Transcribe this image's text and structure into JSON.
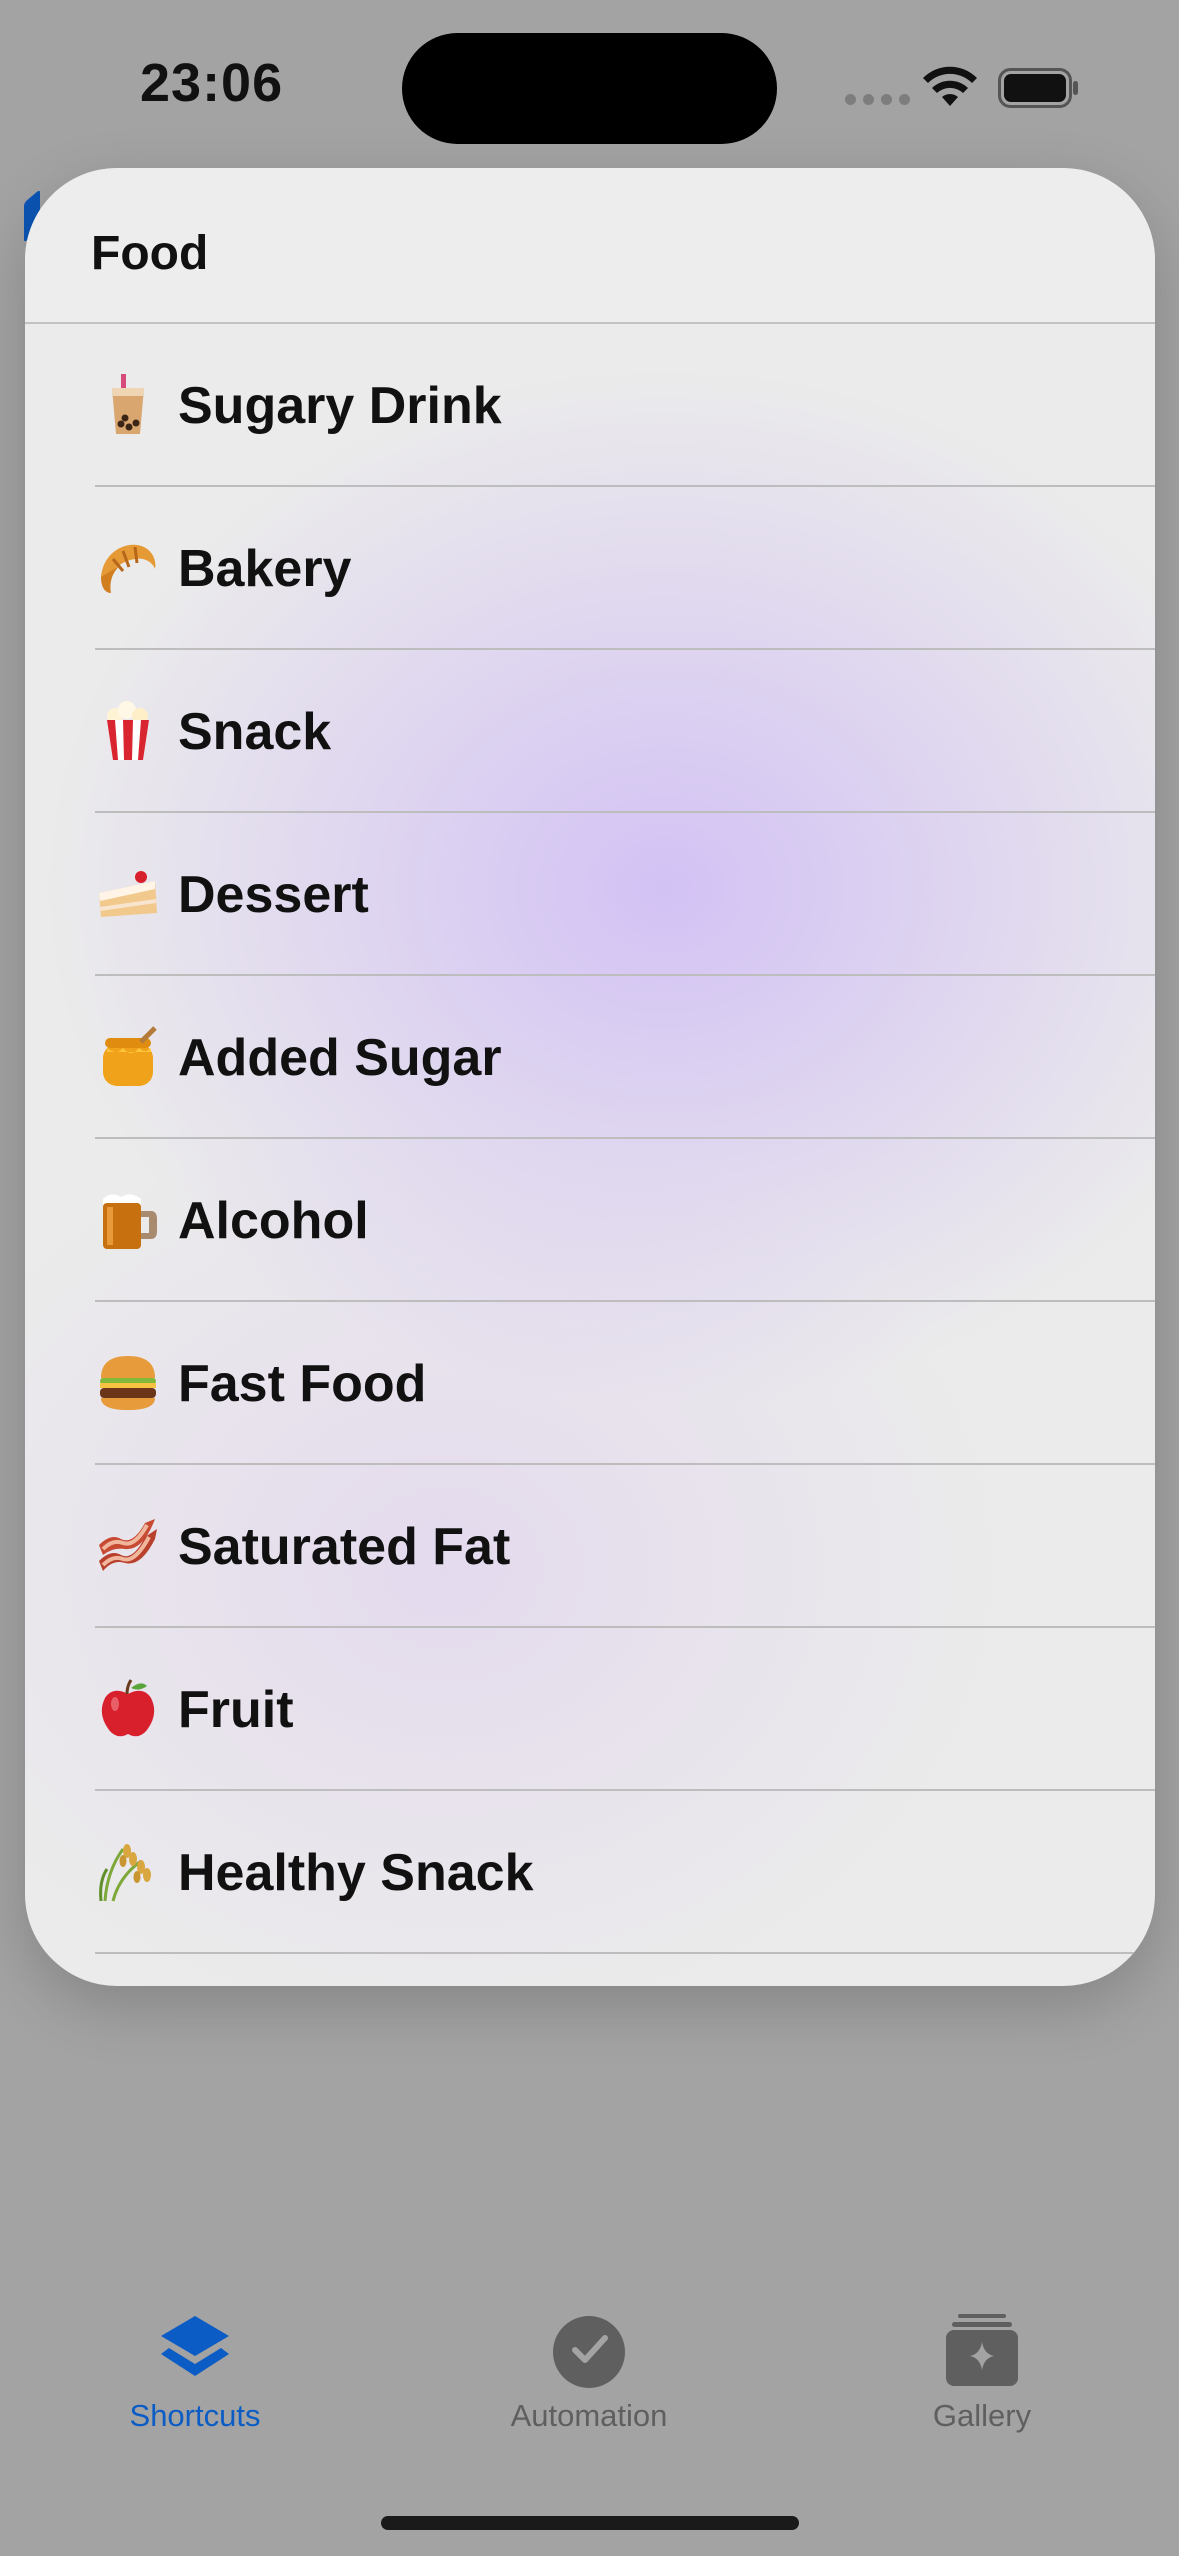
{
  "status_bar": {
    "time": "23:06",
    "wifi_icon": "wifi-icon",
    "battery_icon": "battery-icon"
  },
  "menu": {
    "title": "Food",
    "items": [
      {
        "label": "Sugary Drink",
        "icon": "bubble-tea-icon"
      },
      {
        "label": "Bakery",
        "icon": "croissant-icon"
      },
      {
        "label": "Snack",
        "icon": "popcorn-icon"
      },
      {
        "label": "Dessert",
        "icon": "cake-icon"
      },
      {
        "label": "Added Sugar",
        "icon": "honey-pot-icon"
      },
      {
        "label": "Alcohol",
        "icon": "beer-mug-icon"
      },
      {
        "label": "Fast Food",
        "icon": "hamburger-icon"
      },
      {
        "label": "Saturated Fat",
        "icon": "bacon-icon"
      },
      {
        "label": "Fruit",
        "icon": "apple-icon"
      },
      {
        "label": "Healthy Snack",
        "icon": "rice-stalk-icon"
      }
    ]
  },
  "tab_bar": {
    "tabs": [
      {
        "label": "Shortcuts",
        "icon": "layers-icon",
        "selected": true
      },
      {
        "label": "Automation",
        "icon": "clock-check-icon",
        "selected": false
      },
      {
        "label": "Gallery",
        "icon": "sparkle-stack-icon",
        "selected": false
      }
    ],
    "accent_color": "#0b5cc4",
    "inactive_color": "#5f5f5f"
  }
}
